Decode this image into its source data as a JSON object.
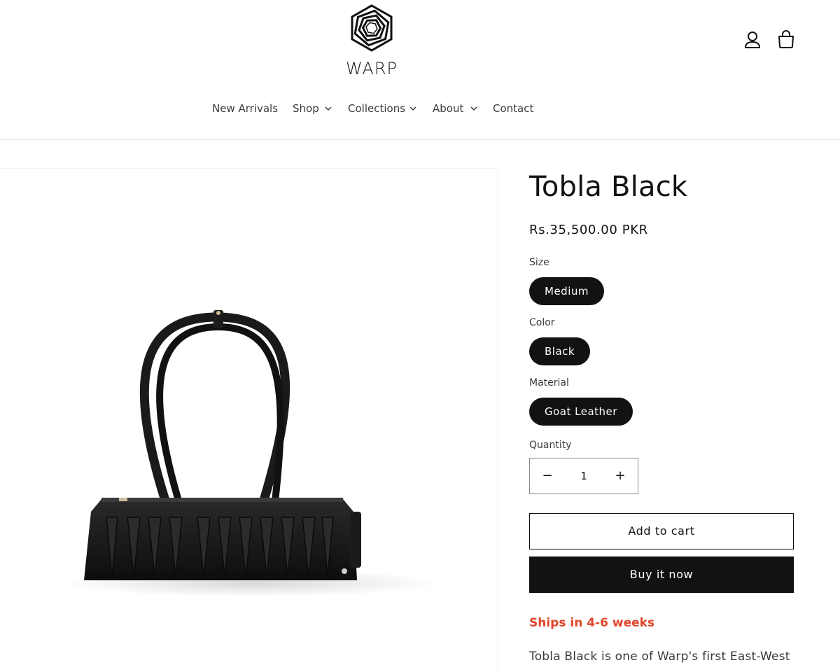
{
  "header": {
    "brand": "WARP",
    "nav": [
      {
        "label": "New Arrivals"
      },
      {
        "label": "Shop"
      },
      {
        "label": "Collections"
      },
      {
        "label": "About"
      },
      {
        "label": "Contact"
      }
    ]
  },
  "product": {
    "title": "Tobla Black",
    "price": "Rs.35,500.00 PKR",
    "options": [
      {
        "label": "Size",
        "value": "Medium"
      },
      {
        "label": "Color",
        "value": "Black"
      },
      {
        "label": "Material",
        "value": "Goat Leather"
      }
    ],
    "quantity_label": "Quantity",
    "quantity": "1",
    "decrement": "−",
    "increment": "+",
    "add_to_cart": "Add to cart",
    "buy_now": "Buy it now",
    "shipping": "Ships in 4-6 weeks",
    "description": "Tobla Black is one of Warp's first East-West"
  },
  "colors": {
    "primary": "#121212",
    "shipping": "#e0462a",
    "border": "#e6e6e6"
  }
}
